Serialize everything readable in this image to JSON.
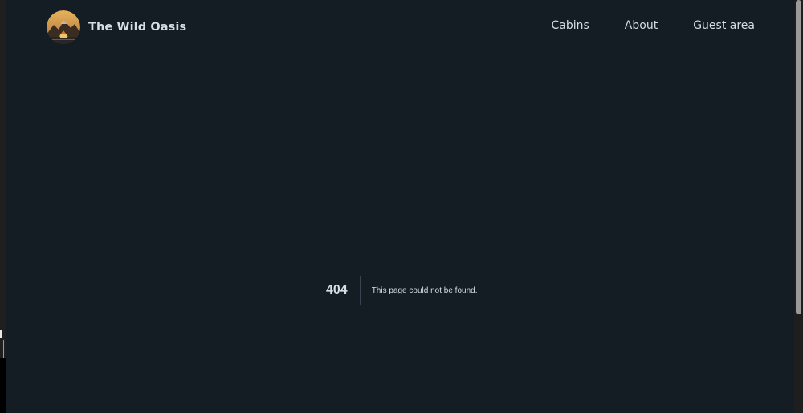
{
  "header": {
    "brand_name": "The Wild Oasis",
    "logo_icon": "cabin-mountain-logo-icon"
  },
  "nav": {
    "items": [
      {
        "label": "Cabins"
      },
      {
        "label": "About"
      },
      {
        "label": "Guest area"
      }
    ]
  },
  "error": {
    "code": "404",
    "message": "This page could not be found."
  },
  "colors": {
    "background": "#141c24",
    "text": "#d4dee7",
    "divider": "#3a4350",
    "logo_accent": "#c6904a"
  }
}
